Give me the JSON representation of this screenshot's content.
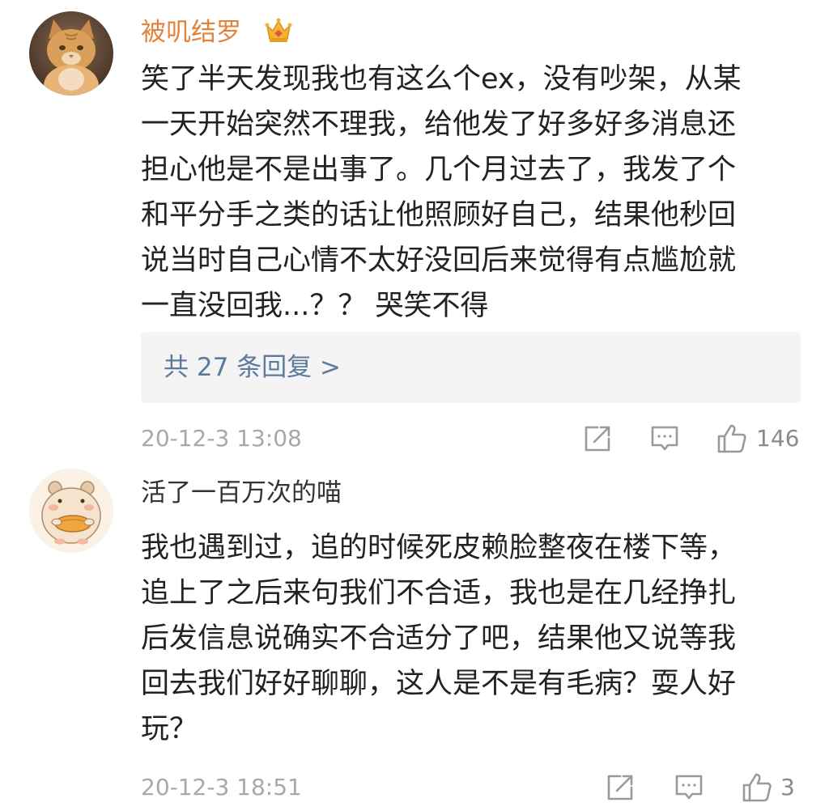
{
  "comments": [
    {
      "username": "被叽结罗",
      "username_color": "#e5813a",
      "badge_icon": "vip-crown-icon",
      "avatar": "cat-photo-avatar",
      "lines": [
        "笑了半天发现我也有这么个ex，没有吵架，从某",
        "一天开始突然不理我，给他发了好多好多消息还",
        "担心他是不是出事了。几个月过去了，我发了个",
        "和平分手之类的话让他照顾好自己，结果他秒回",
        "说当时自己心情不太好没回后来觉得有点尴尬就",
        "一直没回我...？？ 哭笑不得"
      ],
      "replies_label": "共 27 条回复 >",
      "timestamp": "20-12-3 13:08",
      "like_count": "146"
    },
    {
      "username": "活了一百万次的喵",
      "username_color": "#333333",
      "avatar": "hamster-drawing-avatar",
      "lines": [
        "我也遇到过，追的时候死皮赖脸整夜在楼下等，",
        "追上了之后来句我们不合适，我也是在几经挣扎",
        "后发信息说确实不合适分了吧，结果他又说等我",
        "回去我们好好聊聊，这人是不是有毛病？耍人好",
        "玩？"
      ],
      "timestamp": "20-12-3 18:51",
      "like_count": "3"
    }
  ],
  "colors": {
    "body_text": "#222222",
    "meta_text": "#a8a8a8",
    "icon": "#9a9a9a",
    "reply_link": "#5b7a9e",
    "reply_box_bg": "#f4f4f4",
    "badge": "#f2b233"
  }
}
